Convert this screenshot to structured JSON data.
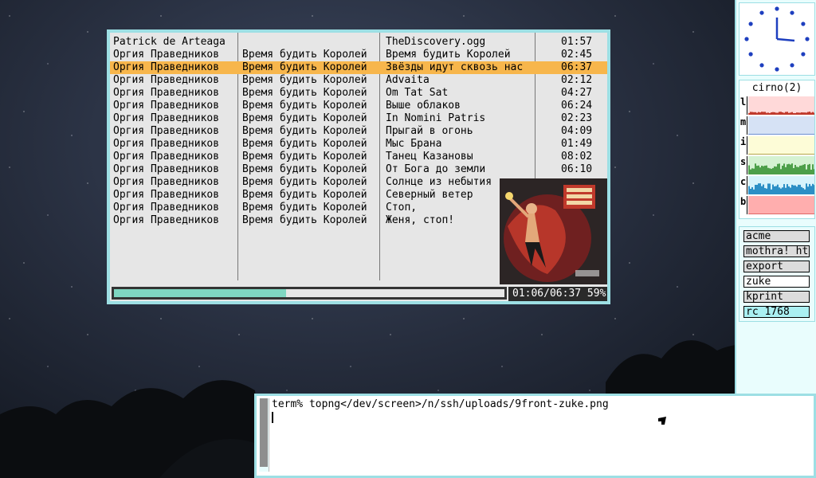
{
  "player": {
    "rows": [
      {
        "artist": "Patrick de Arteaga",
        "album": "",
        "title": "TheDiscovery.ogg",
        "duration": "01:57"
      },
      {
        "artist": "Оргия Праведников",
        "album": "Время будить Королей",
        "title": "Время будить Королей",
        "duration": "02:45"
      },
      {
        "artist": "Оргия Праведников",
        "album": "Время будить Королей",
        "title": "Звёзды идут сквозь нас",
        "duration": "06:37"
      },
      {
        "artist": "Оргия Праведников",
        "album": "Время будить Королей",
        "title": "Advaita",
        "duration": "02:12"
      },
      {
        "artist": "Оргия Праведников",
        "album": "Время будить Королей",
        "title": "Om Tat Sat",
        "duration": "04:27"
      },
      {
        "artist": "Оргия Праведников",
        "album": "Время будить Королей",
        "title": "Выше облаков",
        "duration": "06:24"
      },
      {
        "artist": "Оргия Праведников",
        "album": "Время будить Королей",
        "title": "In Nomini Patris",
        "duration": "02:23"
      },
      {
        "artist": "Оргия Праведников",
        "album": "Время будить Королей",
        "title": "Прыгай в огонь",
        "duration": "04:09"
      },
      {
        "artist": "Оргия Праведников",
        "album": "Время будить Королей",
        "title": "Мыс Брана",
        "duration": "01:49"
      },
      {
        "artist": "Оргия Праведников",
        "album": "Время будить Королей",
        "title": "Танец Казановы",
        "duration": "08:02"
      },
      {
        "artist": "Оргия Праведников",
        "album": "Время будить Королей",
        "title": "От Бога до земли",
        "duration": "06:10"
      },
      {
        "artist": "Оргия Праведников",
        "album": "Время будить Королей",
        "title": "Солнце из небытия",
        "duration": ""
      },
      {
        "artist": "Оргия Праведников",
        "album": "Время будить Королей",
        "title": "Северный ветер",
        "duration": ""
      },
      {
        "artist": "Оргия Праведников",
        "album": "Время будить Королей",
        "title": "Стоп,",
        "duration": ""
      },
      {
        "artist": "Оргия Праведников",
        "album": "Время будить Королей",
        "title": "Женя, стоп!",
        "duration": ""
      }
    ],
    "selected_index": 2,
    "selected_color": "#f7b64c",
    "time_display": "01:06/06:37 59%",
    "progress": 0.44,
    "cover_alt": "album-cover"
  },
  "stats": {
    "title": "cirno(2)",
    "graphs": [
      {
        "label": "l",
        "bg": "#ffd9d9",
        "fg": "#c0392b"
      },
      {
        "label": "m",
        "bg": "#d6e2f5",
        "fg": "#6d8fd1"
      },
      {
        "label": "i",
        "bg": "#fdfcd7",
        "fg": "#b6a74a"
      },
      {
        "label": "s",
        "bg": "#d5f2d2",
        "fg": "#4d9f49"
      },
      {
        "label": "c",
        "bg": "#d7f3fb",
        "fg": "#2c8fc5"
      },
      {
        "label": "b",
        "bg": "#ffaeae",
        "fg": "#e06666"
      }
    ]
  },
  "windows": [
    {
      "label": "acme",
      "bg": "#dcdcdc"
    },
    {
      "label": "mothra! ht",
      "bg": "#dcdcdc"
    },
    {
      "label": "export",
      "bg": "#dcdcdc"
    },
    {
      "label": "zuke",
      "bg": "#ffffff"
    },
    {
      "label": "kprint",
      "bg": "#dcdcdc"
    },
    {
      "label": "rc 1768",
      "bg": "#aaf0f2"
    }
  ],
  "terminal": {
    "command": "term% topng</dev/screen>/n/ssh/uploads/9front-zuke.png"
  },
  "colors": {
    "border": "#9ddfe4",
    "progress_fill": "#7fd6c1",
    "clock_face": "#1e3fbf"
  }
}
